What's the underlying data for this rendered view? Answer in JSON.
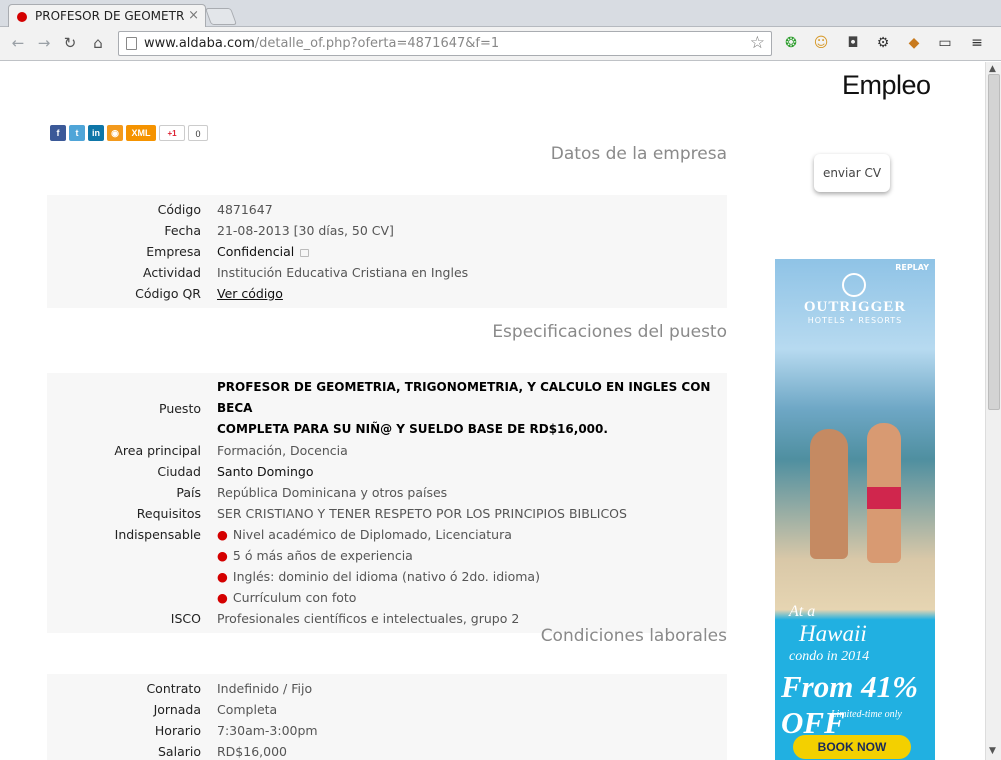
{
  "browser": {
    "tab_title": "PROFESOR DE GEOMETR",
    "url_host": "www.aldaba.com",
    "url_path": "/detalle_of.php?oferta=4871647&f=1"
  },
  "site": {
    "logo": "Empleo"
  },
  "social": {
    "xml_label": "XML",
    "gplus_label": "+1",
    "gplus_count": "0"
  },
  "apply": {
    "label": "enviar CV"
  },
  "company": {
    "title": "Datos de la empresa",
    "rows": [
      {
        "label": "Código",
        "value": "4871647"
      },
      {
        "label": "Fecha",
        "value": "21-08-2013 [30 días, 50 CV]"
      },
      {
        "label": "Empresa",
        "value": "Confidencial"
      },
      {
        "label": "Actividad",
        "value": "Institución Educativa Cristiana en Ingles"
      },
      {
        "label": "Código QR",
        "value": "Ver código"
      }
    ]
  },
  "position": {
    "title": "Especificaciones del puesto",
    "puesto_label": "Puesto",
    "puesto_line1": "PROFESOR DE GEOMETRIA, TRIGONOMETRIA, Y CALCULO EN INGLES CON BECA",
    "puesto_line2": "COMPLETA PARA SU NIÑ@ Y SUELDO BASE DE RD$16,000.",
    "rows": [
      {
        "label": "Area principal",
        "value": "Formación, Docencia"
      },
      {
        "label": "Ciudad",
        "value": "Santo Domingo"
      },
      {
        "label": "País",
        "value": "República Dominicana y otros países"
      },
      {
        "label": "Requisitos",
        "value": "SER CRISTIANO Y TENER RESPETO POR LOS PRINCIPIOS BIBLICOS"
      }
    ],
    "indispensable_label": "Indispensable",
    "indispensable": [
      "Nivel académico de Diplomado, Licenciatura",
      "5 ó más años de experiencia",
      "Inglés: dominio del idioma (nativo ó 2do. idioma)",
      "Currículum con foto"
    ],
    "isco_label": "ISCO",
    "isco_value": "Profesionales científicos e intelectuales, grupo 2"
  },
  "conditions": {
    "title": "Condiciones laborales",
    "rows": [
      {
        "label": "Contrato",
        "value": "Indefinido / Fijo"
      },
      {
        "label": "Jornada",
        "value": "Completa"
      },
      {
        "label": "Horario",
        "value": "7:30am-3:00pm"
      },
      {
        "label": "Salario",
        "value": "RD$16,000"
      }
    ]
  },
  "ad": {
    "replay": "REPLAY",
    "brand": "OUTRIGGER",
    "brand_sub": "HOTELS • RESORTS",
    "line1": "At a",
    "line2": "Hawaii",
    "line3": "condo in 2014",
    "line4": "From 41% OFF",
    "line5": "Limited-time only",
    "cta": "BOOK NOW"
  }
}
